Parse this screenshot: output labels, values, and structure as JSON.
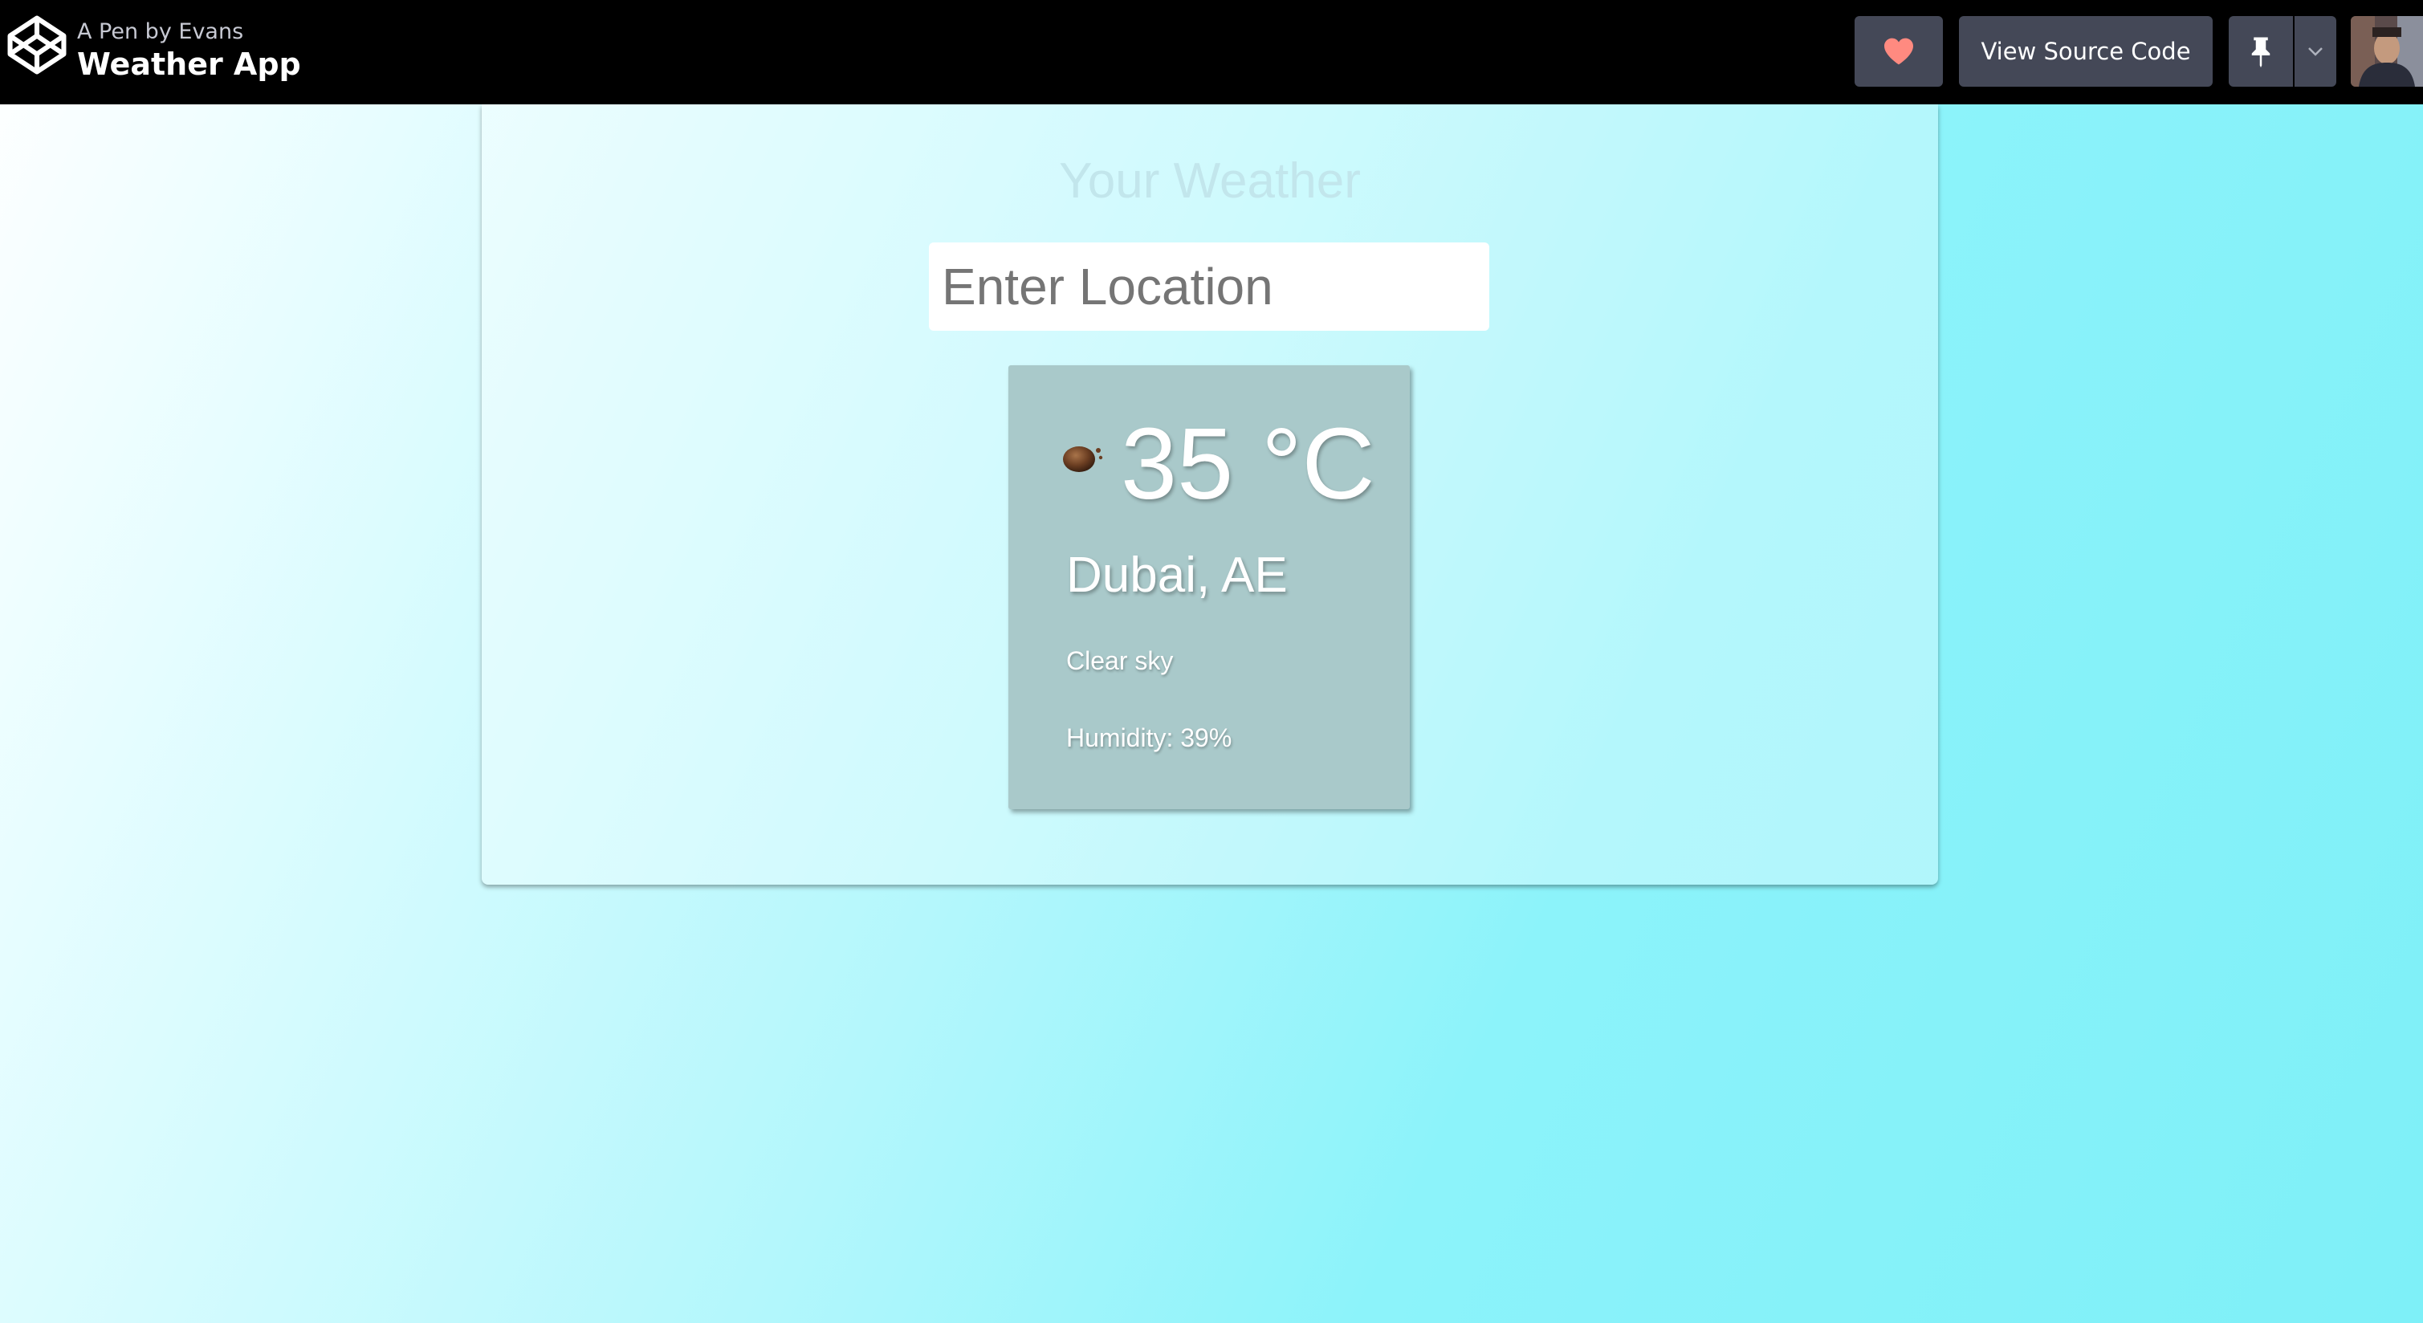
{
  "header": {
    "pen_by": "A Pen by Evans",
    "pen_title": "Weather App",
    "view_source_label": "View Source Code",
    "icons": {
      "logo": "codepen-logo-icon",
      "heart": "heart-icon",
      "pin": "pin-icon",
      "caret": "chevron-down-icon"
    },
    "colors": {
      "bar": "#000000",
      "button": "#444857",
      "heart": "#ff8a80"
    }
  },
  "app": {
    "title": "Your Weather",
    "search": {
      "placeholder": "Enter Location",
      "value": ""
    },
    "weather": {
      "icon": "weather-icon",
      "temperature": "35 °C",
      "location": "Dubai, AE",
      "description": "Clear sky",
      "humidity": "Humidity: 39%"
    },
    "colors": {
      "card": "#a9c9ca",
      "title": "#c2e6ec",
      "background_end": "#7ef0f8"
    }
  }
}
